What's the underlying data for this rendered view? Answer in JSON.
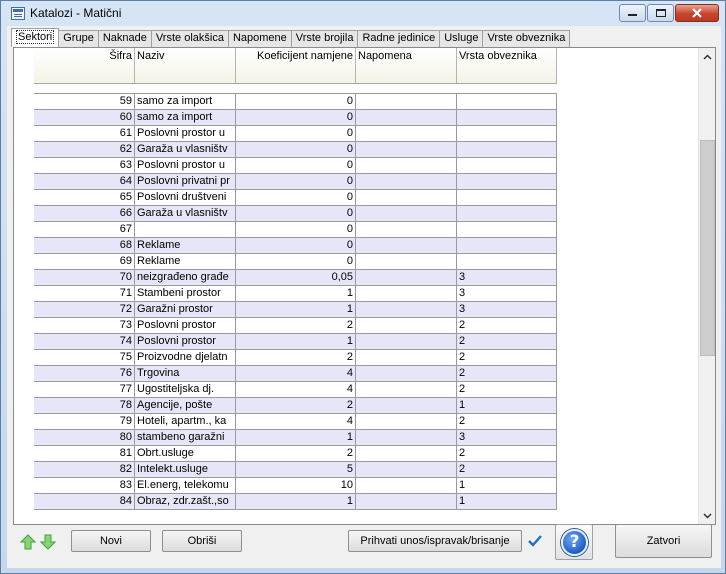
{
  "window": {
    "title": "Katalozi - Matični"
  },
  "tabs": [
    "Sektori",
    "Grupe",
    "Naknade",
    "Vrste olakšica",
    "Napomene",
    "Vrste brojila",
    "Radne jedinice",
    "Usluge",
    "Vrste obveznika"
  ],
  "grid": {
    "columns": [
      "Šifra",
      "Naziv",
      "Koeficijent namjene",
      "Napomena",
      "Vrsta obveznika"
    ],
    "rows": [
      {
        "sifra": "59",
        "naziv": "samo za import",
        "koef": "0",
        "napomena": "",
        "vrsta": ""
      },
      {
        "sifra": "60",
        "naziv": "samo za import",
        "koef": "0",
        "napomena": "",
        "vrsta": ""
      },
      {
        "sifra": "61",
        "naziv": "Poslovni prostor u",
        "koef": "0",
        "napomena": "",
        "vrsta": ""
      },
      {
        "sifra": "62",
        "naziv": "Garaža u vlasništv",
        "koef": "0",
        "napomena": "",
        "vrsta": ""
      },
      {
        "sifra": "63",
        "naziv": "Poslovni prostor u",
        "koef": "0",
        "napomena": "",
        "vrsta": ""
      },
      {
        "sifra": "64",
        "naziv": "Poslovni privatni pr",
        "koef": "0",
        "napomena": "",
        "vrsta": ""
      },
      {
        "sifra": "65",
        "naziv": "Poslovni društveni",
        "koef": "0",
        "napomena": "",
        "vrsta": ""
      },
      {
        "sifra": "66",
        "naziv": "Garaža u vlasništv",
        "koef": "0",
        "napomena": "",
        "vrsta": ""
      },
      {
        "sifra": "67",
        "naziv": "",
        "koef": "0",
        "napomena": "",
        "vrsta": ""
      },
      {
        "sifra": "68",
        "naziv": "Reklame",
        "koef": "0",
        "napomena": "",
        "vrsta": ""
      },
      {
        "sifra": "69",
        "naziv": "Reklame",
        "koef": "0",
        "napomena": "",
        "vrsta": ""
      },
      {
        "sifra": "70",
        "naziv": "neizgrađeno građe",
        "koef": "0,05",
        "napomena": "",
        "vrsta": "3"
      },
      {
        "sifra": "71",
        "naziv": "Stambeni prostor",
        "koef": "1",
        "napomena": "",
        "vrsta": "3"
      },
      {
        "sifra": "72",
        "naziv": "Garažni prostor",
        "koef": "1",
        "napomena": "",
        "vrsta": "3"
      },
      {
        "sifra": "73",
        "naziv": "Poslovni prostor",
        "koef": "2",
        "napomena": "",
        "vrsta": "2"
      },
      {
        "sifra": "74",
        "naziv": "Poslovni prostor",
        "koef": "1",
        "napomena": "",
        "vrsta": "2"
      },
      {
        "sifra": "75",
        "naziv": "Proizvodne djelatn",
        "koef": "2",
        "napomena": "",
        "vrsta": "2"
      },
      {
        "sifra": "76",
        "naziv": "Trgovina",
        "koef": "4",
        "napomena": "",
        "vrsta": "2"
      },
      {
        "sifra": "77",
        "naziv": "Ugostiteljska dj.",
        "koef": "4",
        "napomena": "",
        "vrsta": "2"
      },
      {
        "sifra": "78",
        "naziv": "Agencije, pošte",
        "koef": "2",
        "napomena": "",
        "vrsta": "1"
      },
      {
        "sifra": "79",
        "naziv": "Hoteli, apartm., ka",
        "koef": "4",
        "napomena": "",
        "vrsta": "2"
      },
      {
        "sifra": "80",
        "naziv": "stambeno garažni",
        "koef": "1",
        "napomena": "",
        "vrsta": "3"
      },
      {
        "sifra": "81",
        "naziv": "Obrt.usluge",
        "koef": "2",
        "napomena": "",
        "vrsta": "2"
      },
      {
        "sifra": "82",
        "naziv": "Intelekt.usluge",
        "koef": "5",
        "napomena": "",
        "vrsta": "2"
      },
      {
        "sifra": "83",
        "naziv": "El.energ, telekomu",
        "koef": "10",
        "napomena": "",
        "vrsta": "1"
      },
      {
        "sifra": "84",
        "naziv": "Obraz, zdr.zašt.,so",
        "koef": "1",
        "napomena": "",
        "vrsta": "1"
      }
    ]
  },
  "toolbar": {
    "novi": "Novi",
    "obrisi": "Obriši",
    "prihvati": "Prihvati unos/ispravak/brisanje",
    "help": "?",
    "zatvori": "Zatvori"
  },
  "icons": {
    "up": "arrow-up-icon",
    "down": "arrow-down-icon",
    "check": "checkmark-icon",
    "help": "help-icon"
  },
  "colors": {
    "alt_row": "#e6e6f8",
    "arrow_green": "#3aa53a",
    "check_blue": "#1f6fd0"
  }
}
